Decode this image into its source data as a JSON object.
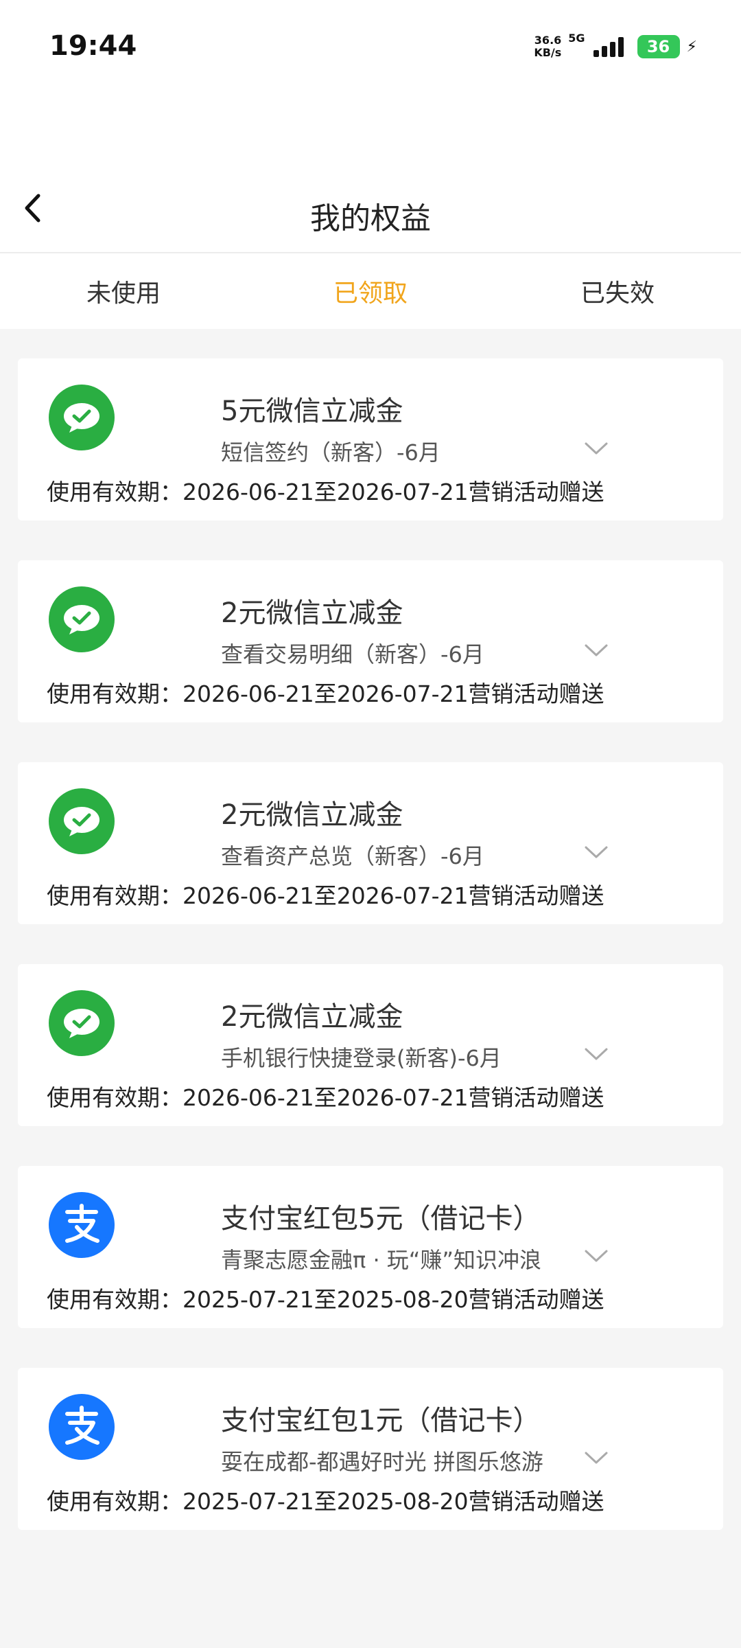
{
  "status_bar": {
    "time": "19:44",
    "net_speed_value": "36.6",
    "net_speed_unit": "KB/s",
    "network": "5G",
    "battery": "36"
  },
  "header": {
    "title": "我的权益"
  },
  "tabs": [
    {
      "label": "未使用",
      "active": false
    },
    {
      "label": "已领取",
      "active": true
    },
    {
      "label": "已失效",
      "active": false
    }
  ],
  "colors": {
    "accent": "#f1a51c",
    "wechat_green": "#2aae42",
    "alipay_blue": "#1677ff"
  },
  "cards": [
    {
      "logo": "wechat-icon",
      "title": "5元微信立减金",
      "subtitle": "短信签约（新客）-6月",
      "validity": "使用有效期：2026-06-21至2026-07-21营销活动赠送"
    },
    {
      "logo": "wechat-icon",
      "title": "2元微信立减金",
      "subtitle": "查看交易明细（新客）-6月",
      "validity": "使用有效期：2026-06-21至2026-07-21营销活动赠送"
    },
    {
      "logo": "wechat-icon",
      "title": "2元微信立减金",
      "subtitle": "查看资产总览（新客）-6月",
      "validity": "使用有效期：2026-06-21至2026-07-21营销活动赠送"
    },
    {
      "logo": "wechat-icon",
      "title": "2元微信立减金",
      "subtitle": "手机银行快捷登录(新客)-6月",
      "validity": "使用有效期：2026-06-21至2026-07-21营销活动赠送"
    },
    {
      "logo": "alipay-icon",
      "title": "支付宝红包5元（借记卡）",
      "subtitle": "青聚志愿金融π · 玩“赚”知识冲浪",
      "validity": "使用有效期：2025-07-21至2025-08-20营销活动赠送"
    },
    {
      "logo": "alipay-icon",
      "title": "支付宝红包1元（借记卡）",
      "subtitle": "耍在成都-都遇好时光 拼图乐悠游",
      "validity": "使用有效期：2025-07-21至2025-08-20营销活动赠送"
    }
  ]
}
